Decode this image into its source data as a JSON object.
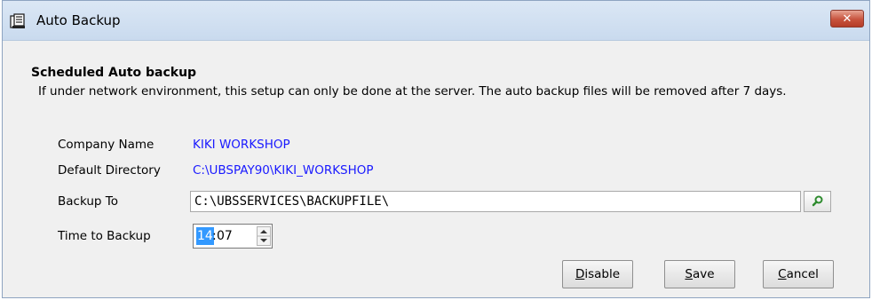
{
  "window": {
    "title": "Auto Backup",
    "app_icon": "backup-server-icon",
    "close_label": "✕"
  },
  "section": {
    "heading": "Scheduled Auto backup",
    "description": "If under network environment, this setup can only be done at the server. The auto backup files will be removed after 7 days."
  },
  "form": {
    "company_name_label": "Company Name",
    "company_name_value": "KIKI WORKSHOP",
    "default_directory_label": "Default Directory",
    "default_directory_value": "C:\\UBSPAY90\\KIKI_WORKSHOP",
    "backup_to_label": "Backup To",
    "backup_to_value": "C:\\UBSSERVICES\\BACKUPFILE\\",
    "browse_icon": "search-icon",
    "time_label": "Time to Backup",
    "time_hours": "14",
    "time_separator": ":",
    "time_minutes": "07"
  },
  "buttons": {
    "disable_first": "D",
    "disable_rest": "isable",
    "save_first": "S",
    "save_rest": "ave",
    "cancel_first": "C",
    "cancel_rest": "ancel"
  },
  "colors": {
    "link_value": "#1a1aff",
    "selection": "#3399ff",
    "close_red": "#c7533d"
  }
}
